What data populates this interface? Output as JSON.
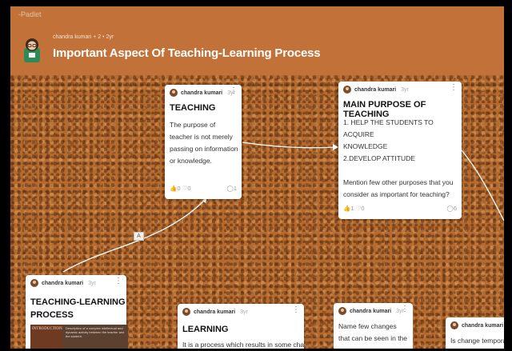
{
  "app": {
    "brand": "-Padlet"
  },
  "header": {
    "meta": "chandra kumari + 2 • 2yr",
    "title": "Important Aspect Of Teaching-Learning Process"
  },
  "connector_label": "A",
  "cards": {
    "teaching": {
      "author": "chandra kumari",
      "time": "3yr",
      "title": "TEACHING",
      "body": "The purpose of teacher is not merely passing on information or knowledge.",
      "likes": "0",
      "votes": "0",
      "comments": "1"
    },
    "purpose": {
      "author": "chandra kumari",
      "time": "3yr",
      "title": "MAIN PURPOSE OF TEACHING",
      "body_lines": [
        "1. HELP THE STUDENTS TO ACQUIRE",
        "KNOWLEDGE",
        "2.DEVELOP ATTITUDE",
        "",
        "Mention few other purposes that you",
        "consider as important for teaching?"
      ],
      "likes": "1",
      "votes": "0",
      "comments": "6"
    },
    "tlp": {
      "author": "chandra kumari",
      "time": "3yr",
      "title_line1": "TEACHING-LEARNING",
      "title_line2": "PROCESS",
      "thumb_left": "INTRODUCTION",
      "thumb_right": "Description of a complex intellectual and dynamic activity between the teacher and the student."
    },
    "learning": {
      "author": "chandra kumari",
      "time": "3yr",
      "title": "LEARNING",
      "body": "It is a process which results in some change"
    },
    "changes": {
      "author": "chandra kumari",
      "time": "3yr",
      "body": "Name few changes that can be seen in the"
    },
    "temporary": {
      "author": "chandra kumari",
      "body": "Is change tempora"
    }
  }
}
